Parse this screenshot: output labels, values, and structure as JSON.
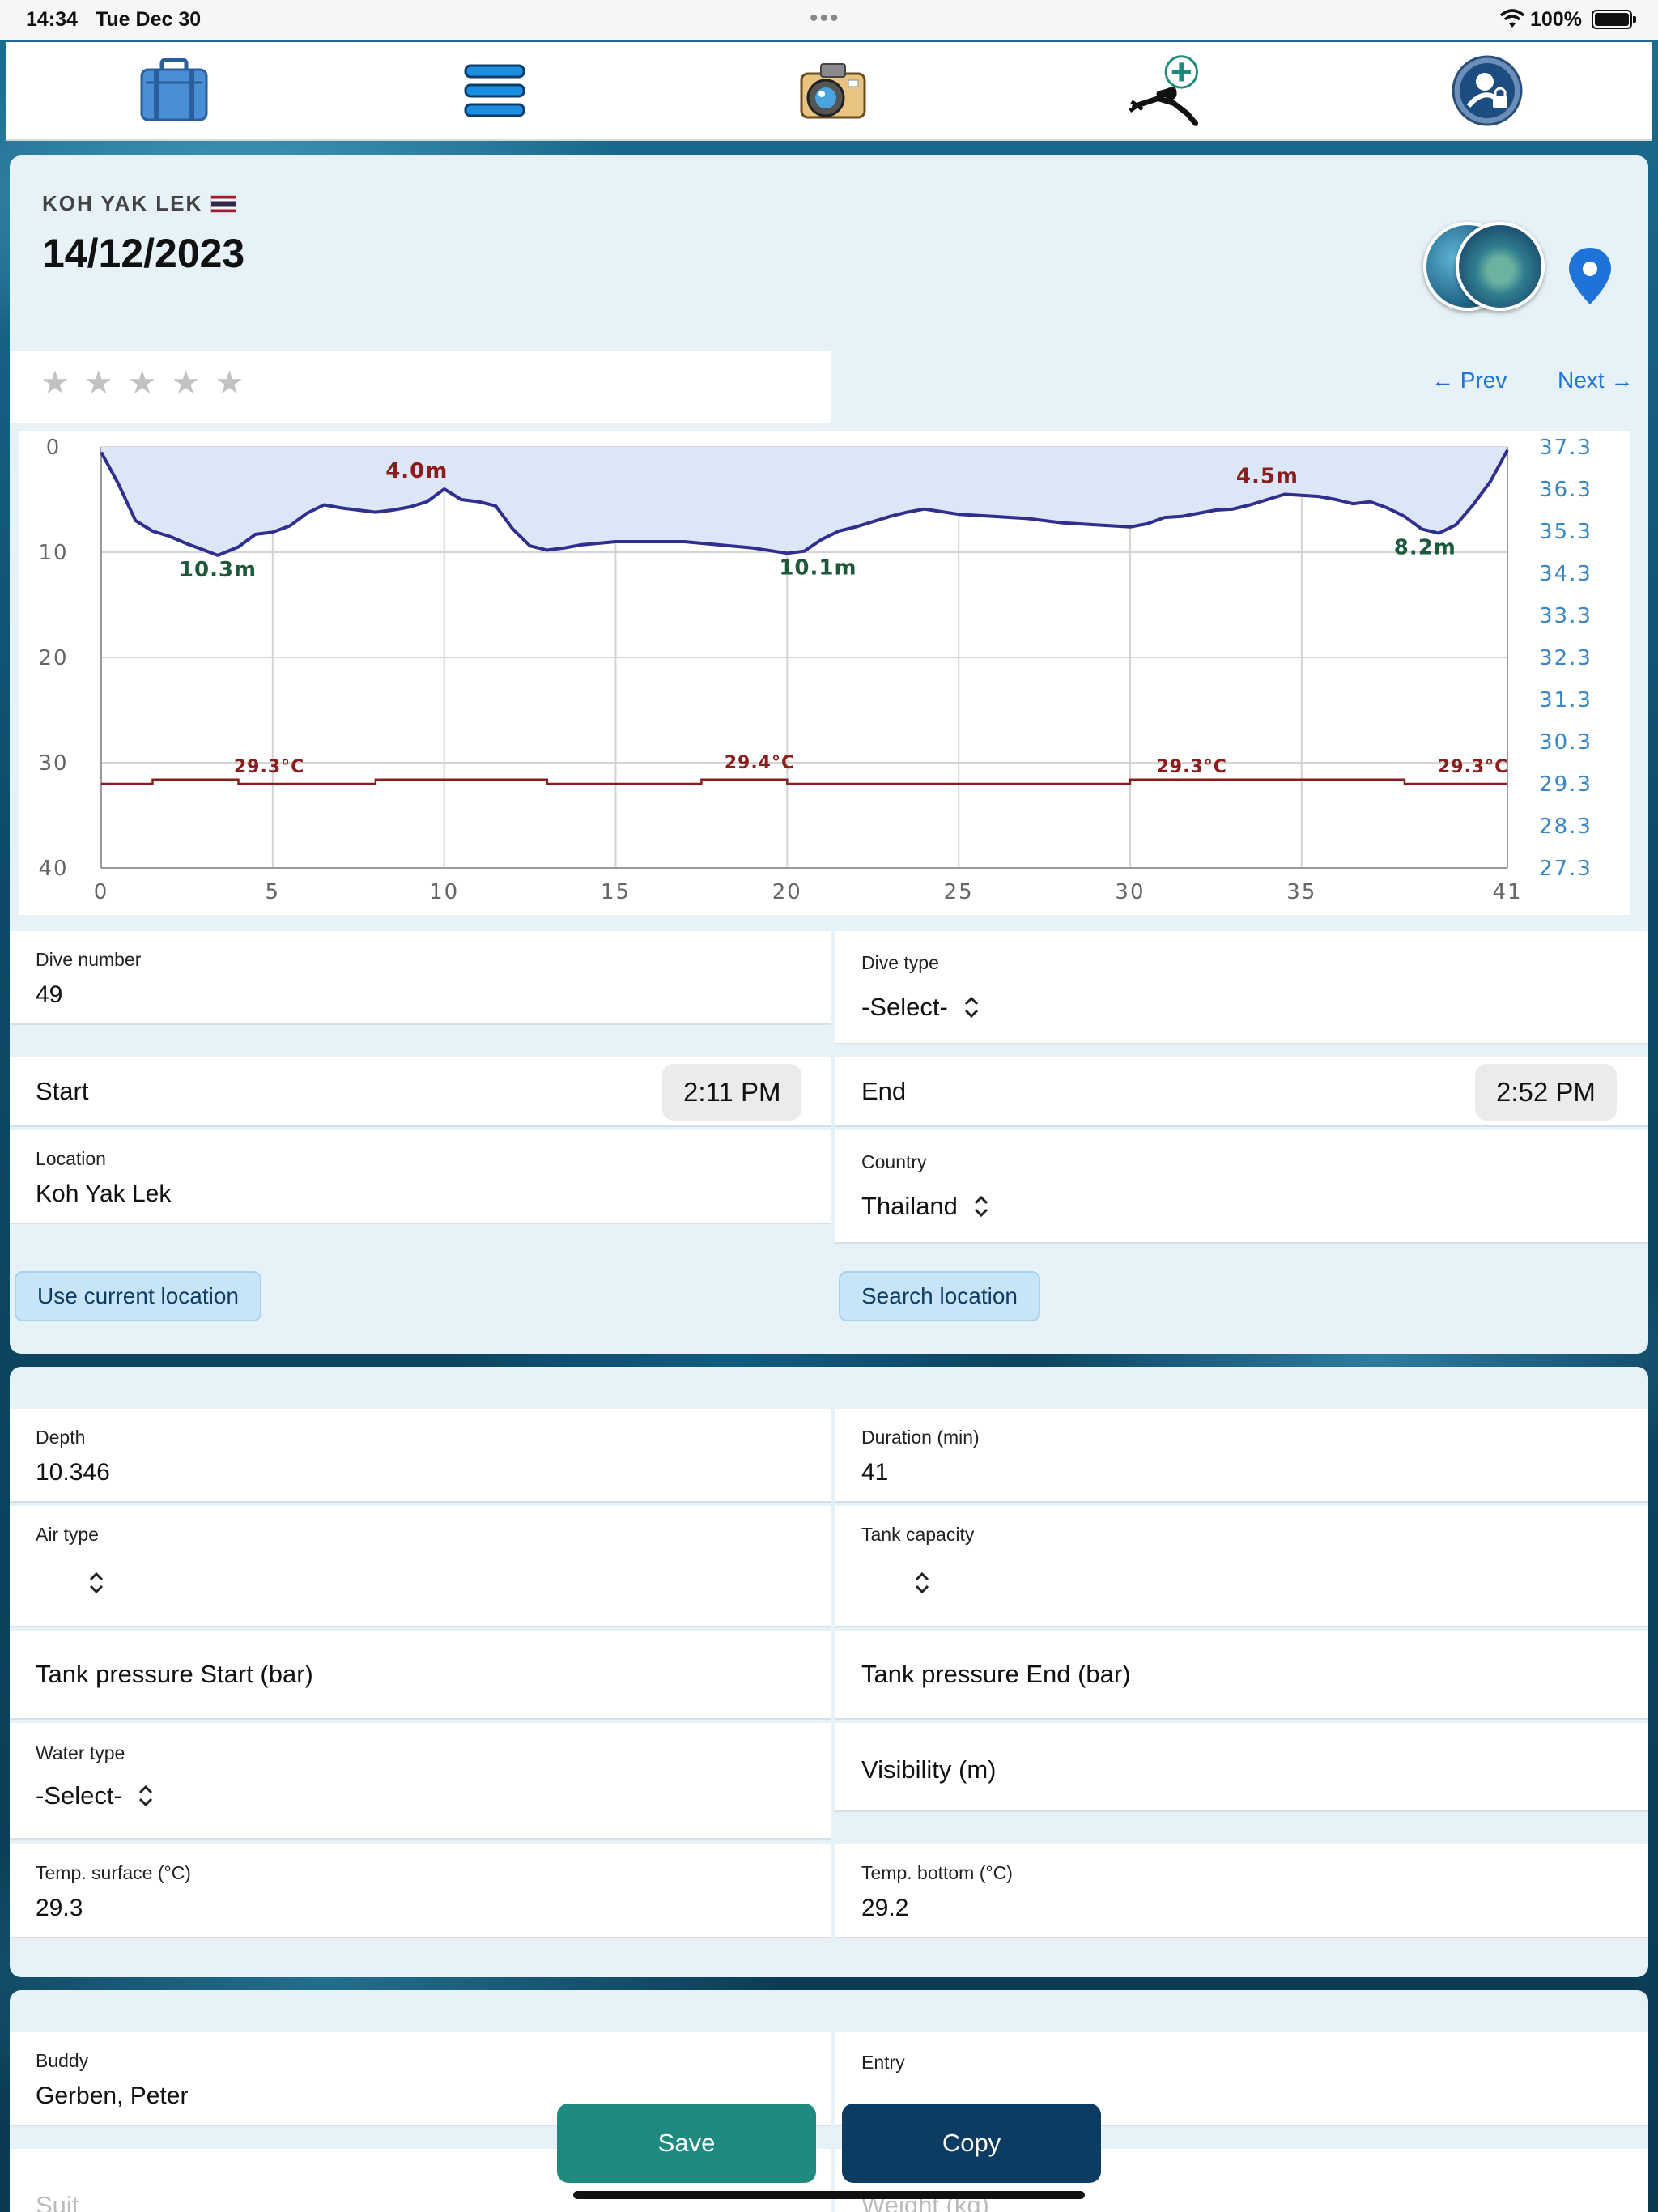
{
  "status_bar": {
    "time": "14:34",
    "date": "Tue Dec 30",
    "battery": "100%"
  },
  "nav": {
    "icons": [
      "suitcase-icon",
      "menu-icon",
      "camera-icon",
      "add-diver-icon",
      "profile-lock-icon"
    ]
  },
  "dive": {
    "site_name": "KOH YAK LEK",
    "date": "14/12/2023",
    "rating_max": 5,
    "rating_value": 0,
    "prev_label": "← Prev",
    "next_label": "Next →"
  },
  "chart_data": {
    "type": "line",
    "x_ticks": [
      "0",
      "5",
      "10",
      "15",
      "20",
      "25",
      "30",
      "35",
      "41"
    ],
    "y_left_ticks": [
      "0",
      "10",
      "20",
      "30",
      "40"
    ],
    "y_right_ticks": [
      "37.3",
      "36.3",
      "35.3",
      "34.3",
      "33.3",
      "32.3",
      "31.3",
      "30.3",
      "29.3",
      "28.3",
      "27.3"
    ],
    "xlim": [
      0,
      41
    ],
    "ylim_depth": [
      0,
      40
    ],
    "ylim_temp": [
      27.3,
      37.3
    ],
    "grid": true,
    "series": [
      {
        "color": "#2e2f8f",
        "x": [
          0,
          0.5,
          1,
          1.5,
          2,
          2.5,
          3,
          3.4,
          4,
          4.5,
          5,
          5.5,
          6,
          6.5,
          7,
          7.5,
          8,
          8.5,
          9,
          9.5,
          10,
          10.5,
          11,
          11.5,
          12,
          12.5,
          13,
          13.5,
          14,
          15,
          16,
          17,
          18,
          19,
          20,
          20.5,
          21,
          21.5,
          22,
          22.5,
          23,
          23.5,
          24,
          25,
          26,
          27,
          28,
          29,
          30,
          30.5,
          31,
          31.5,
          32,
          32.5,
          33,
          33.5,
          34,
          34.5,
          35,
          35.5,
          36,
          36.5,
          37,
          37.5,
          38,
          38.5,
          39,
          39.5,
          40,
          40.5,
          41
        ],
        "values": [
          0.5,
          3.5,
          7,
          8,
          8.5,
          9.2,
          9.8,
          10.3,
          9.5,
          8.3,
          8.1,
          7.5,
          6.3,
          5.5,
          5.8,
          6.0,
          6.2,
          6.0,
          5.7,
          5.2,
          4.0,
          5.0,
          5.2,
          5.6,
          7.8,
          9.4,
          9.8,
          9.6,
          9.3,
          9.0,
          9.0,
          9.0,
          9.3,
          9.6,
          10.1,
          9.9,
          8.8,
          8.0,
          7.6,
          7.1,
          6.6,
          6.2,
          5.9,
          6.4,
          6.6,
          6.8,
          7.2,
          7.4,
          7.6,
          7.3,
          6.7,
          6.6,
          6.3,
          6.0,
          5.9,
          5.5,
          5.0,
          4.5,
          4.6,
          4.7,
          5.0,
          5.4,
          5.2,
          5.8,
          6.6,
          7.8,
          8.2,
          7.4,
          5.5,
          3.3,
          0.3
        ]
      },
      {
        "color": "#8b1d1d",
        "x": [
          0,
          1,
          1.5,
          2,
          3,
          4,
          5,
          6,
          7,
          8,
          9,
          10,
          11,
          12,
          13,
          14,
          15,
          16,
          17,
          17.5,
          18,
          19,
          20,
          21,
          22,
          23,
          24,
          25,
          26,
          27,
          28,
          29,
          30,
          31,
          32,
          33,
          34,
          35,
          36,
          37,
          38,
          39,
          40,
          41
        ],
        "values": [
          29.3,
          29.3,
          29.4,
          29.4,
          29.4,
          29.3,
          29.3,
          29.3,
          29.3,
          29.4,
          29.4,
          29.4,
          29.4,
          29.4,
          29.3,
          29.3,
          29.3,
          29.3,
          29.3,
          29.4,
          29.4,
          29.4,
          29.3,
          29.3,
          29.3,
          29.3,
          29.3,
          29.3,
          29.3,
          29.3,
          29.3,
          29.3,
          29.4,
          29.4,
          29.4,
          29.4,
          29.4,
          29.4,
          29.4,
          29.4,
          29.3,
          29.3,
          29.3,
          29.3
        ]
      }
    ],
    "annotations": [
      {
        "text": "10.3m",
        "x": 3.4,
        "y": 10.3,
        "color": "#1d5a3a"
      },
      {
        "text": "4.0m",
        "x": 9.2,
        "y": 4.0,
        "color": "#8b1d1d"
      },
      {
        "text": "10.1m",
        "x": 20.9,
        "y": 10.1,
        "color": "#1d5a3a"
      },
      {
        "text": "4.5m",
        "x": 34.0,
        "y": 4.5,
        "color": "#8b1d1d"
      },
      {
        "text": "8.2m",
        "x": 38.6,
        "y": 8.2,
        "color": "#1d5a3a"
      },
      {
        "text": "29.3°C",
        "x": 4.9,
        "y": 29.3,
        "color": "#8b1d1d"
      },
      {
        "text": "29.4°C",
        "x": 19.2,
        "y": 29.4,
        "color": "#8b1d1d"
      },
      {
        "text": "29.3°C",
        "x": 31.8,
        "y": 29.3,
        "color": "#8b1d1d"
      },
      {
        "text": "29.3°C",
        "x": 40.0,
        "y": 29.3,
        "color": "#8b1d1d"
      }
    ]
  },
  "form": {
    "dive_number": {
      "label": "Dive number",
      "value": "49"
    },
    "dive_type": {
      "label": "Dive type",
      "value": "-Select-"
    },
    "start": {
      "label": "Start",
      "value": "2:11 PM"
    },
    "end": {
      "label": "End",
      "value": "2:52 PM"
    },
    "location": {
      "label": "Location",
      "value": "Koh Yak Lek"
    },
    "country": {
      "label": "Country",
      "value": "Thailand"
    },
    "use_current_location": "Use current location",
    "search_location": "Search location",
    "depth": {
      "label": "Depth",
      "value": "10.346"
    },
    "duration": {
      "label": "Duration (min)",
      "value": "41"
    },
    "air_type": {
      "label": "Air type",
      "value": ""
    },
    "tank_capacity": {
      "label": "Tank capacity",
      "value": ""
    },
    "tank_pressure_start": {
      "label": "Tank pressure Start (bar)"
    },
    "tank_pressure_end": {
      "label": "Tank pressure End (bar)"
    },
    "water_type": {
      "label": "Water type",
      "value": "-Select-"
    },
    "visibility": {
      "label": "Visibility (m)"
    },
    "temp_surface": {
      "label": "Temp. surface (°C)",
      "value": "29.3"
    },
    "temp_bottom": {
      "label": "Temp. bottom (°C)",
      "value": "29.2"
    },
    "buddy": {
      "label": "Buddy",
      "value": "Gerben, Peter"
    },
    "entry": {
      "label": "Entry"
    },
    "suit": {
      "label": "Suit"
    },
    "weight": {
      "label": "Weight (kg)"
    }
  },
  "buttons": {
    "save": "Save",
    "copy": "Copy"
  },
  "colors": {
    "accent_blue": "#1f73d8",
    "save_green": "#1e8a80",
    "copy_navy": "#0d3c63",
    "depth_line": "#2e2f8f",
    "temp_line": "#8b1d1d"
  }
}
